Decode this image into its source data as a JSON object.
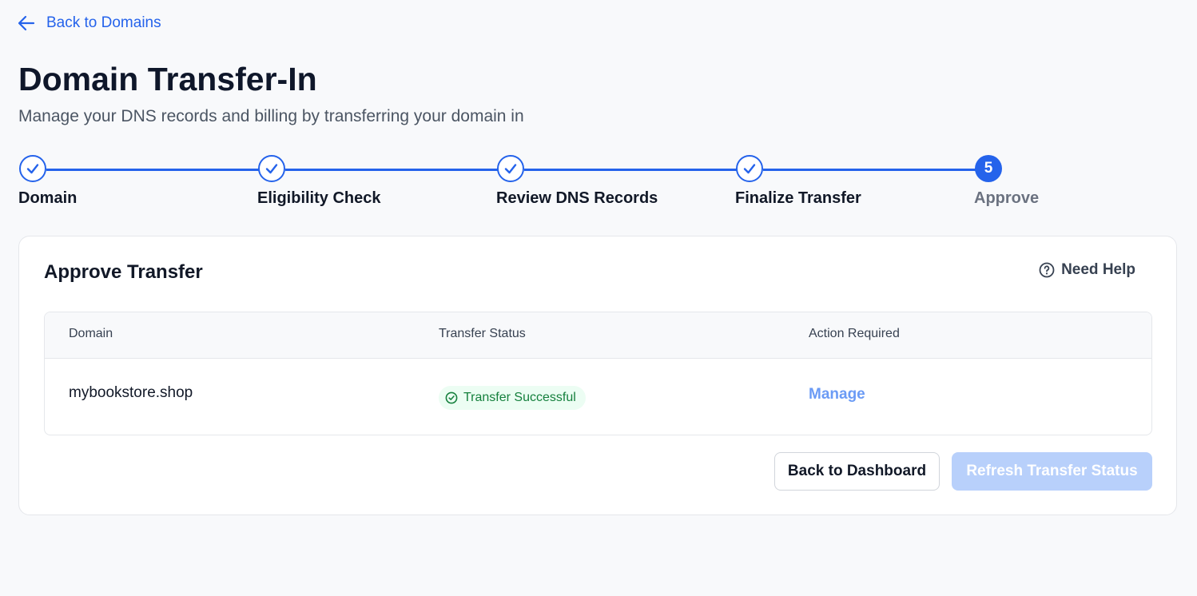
{
  "nav": {
    "back_label": "Back to Domains"
  },
  "page": {
    "title": "Domain Transfer-In",
    "subtitle": "Manage your DNS records and billing by transferring your domain in"
  },
  "stepper": {
    "accent_color": "#2563eb",
    "steps": [
      {
        "label": "Domain",
        "state": "completed"
      },
      {
        "label": "Eligibility Check",
        "state": "completed"
      },
      {
        "label": "Review DNS Records",
        "state": "completed"
      },
      {
        "label": "Finalize Transfer",
        "state": "completed"
      },
      {
        "label": "Approve",
        "number": "5",
        "state": "current"
      }
    ]
  },
  "card": {
    "title": "Approve Transfer",
    "help_label": "Need Help",
    "table": {
      "columns": [
        "Domain",
        "Transfer Status",
        "Action Required"
      ],
      "rows": [
        {
          "domain": "mybookstore.shop",
          "status": "Transfer Successful",
          "action": "Manage"
        }
      ]
    },
    "buttons": {
      "secondary": "Back to Dashboard",
      "primary": "Refresh Transfer Status"
    }
  }
}
